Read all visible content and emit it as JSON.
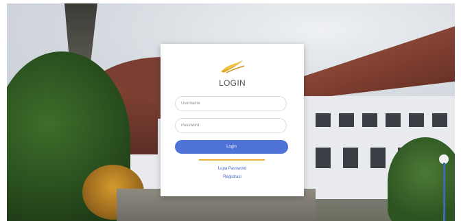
{
  "login": {
    "title": "LOGIN",
    "username_placeholder": "Username",
    "password_placeholder": "Password",
    "login_button": "Login",
    "forgot_password": "Lupa Password",
    "register": "Registrasi"
  },
  "theme": {
    "accent": "#4f72d6",
    "divider_color": "#e6b53a",
    "link_color": "#3b63c4"
  }
}
